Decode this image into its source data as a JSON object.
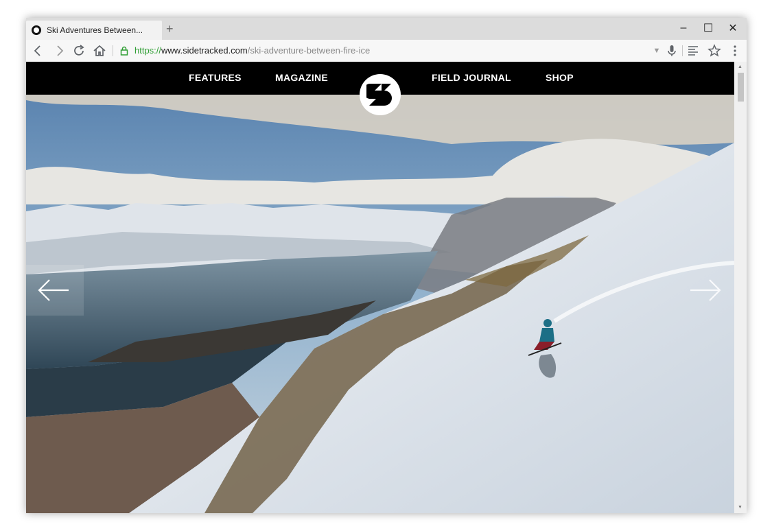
{
  "browser": {
    "tab_title": "Ski Adventures Between...",
    "new_tab_symbol": "+",
    "url_scheme": "https://",
    "url_host": "www.sidetracked.com",
    "url_path": "/ski-adventure-between-fire-ice",
    "window_controls": {
      "minimize": "–",
      "maximize": "☐",
      "close": "✕"
    }
  },
  "site": {
    "nav_left": [
      "FEATURES",
      "MAGAZINE"
    ],
    "nav_right": [
      "FIELD JOURNAL",
      "SHOP"
    ],
    "logo_letter": "S"
  },
  "hero": {
    "prev_icon": "arrow-left-icon",
    "next_icon": "arrow-right-icon"
  },
  "icons": [
    "back-icon",
    "forward-icon",
    "reload-icon",
    "home-icon",
    "lock-icon",
    "dropdown-icon",
    "microphone-icon",
    "reader-mode-icon",
    "star-icon",
    "menu-icon"
  ],
  "colors": {
    "nav_bg": "#000000",
    "url_scheme": "#2e9e33",
    "url_path": "#888888"
  }
}
